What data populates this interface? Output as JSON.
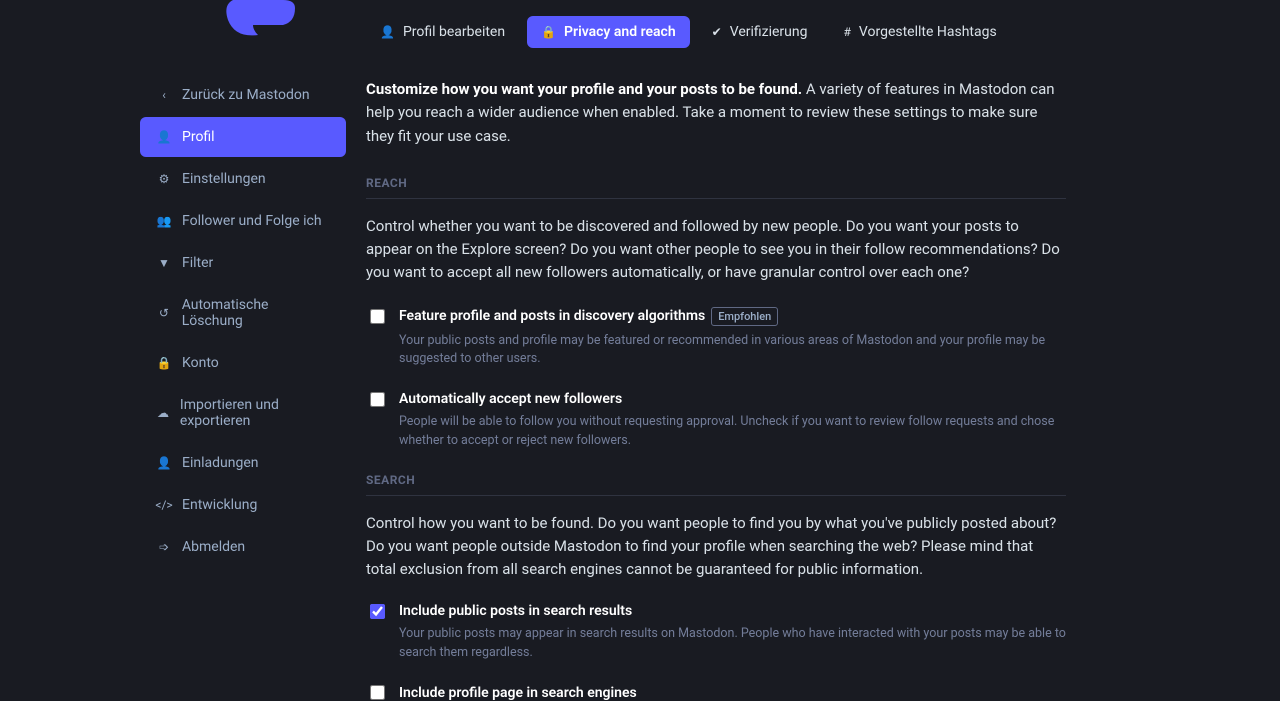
{
  "sidebar": {
    "back_label": "Zurück zu Mastodon",
    "items": [
      {
        "label": "Profil"
      },
      {
        "label": "Einstellungen"
      },
      {
        "label": "Follower und Folge ich"
      },
      {
        "label": "Filter"
      },
      {
        "label": "Automatische Löschung"
      },
      {
        "label": "Konto"
      },
      {
        "label": "Importieren und exportieren"
      },
      {
        "label": "Einladungen"
      },
      {
        "label": "Entwicklung"
      },
      {
        "label": "Abmelden"
      }
    ]
  },
  "tabs": {
    "edit": "Profil bearbeiten",
    "privacy": "Privacy and reach",
    "verify": "Verifizierung",
    "hashtags": "Vorgestellte Hashtags"
  },
  "intro": {
    "bold": "Customize how you want your profile and your posts to be found.",
    "rest": " A variety of features in Mastodon can help you reach a wider audience when enabled. Take a moment to review these settings to make sure they fit your use case."
  },
  "reach": {
    "header": "REACH",
    "desc": "Control whether you want to be discovered and followed by new people. Do you want your posts to appear on the Explore screen? Do you want other people to see you in their follow recommendations? Do you want to accept all new followers automatically, or have granular control over each one?",
    "feature": {
      "label": "Feature profile and posts in discovery algorithms",
      "badge": "Empfohlen",
      "hint": "Your public posts and profile may be featured or recommended in various areas of Mastodon and your profile may be suggested to other users."
    },
    "autoaccept": {
      "label": "Automatically accept new followers",
      "hint": "People will be able to follow you without requesting approval. Uncheck if you want to review follow requests and chose whether to accept or reject new followers."
    }
  },
  "search": {
    "header": "SEARCH",
    "desc": "Control how you want to be found. Do you want people to find you by what you've publicly posted about? Do you want people outside Mastodon to find your profile when searching the web? Please mind that total exclusion from all search engines cannot be guaranteed for public information.",
    "publicposts": {
      "label": "Include public posts in search results",
      "hint": "Your public posts may appear in search results on Mastodon. People who have interacted with your posts may be able to search them regardless."
    },
    "profilepage": {
      "label": "Include profile page in search engines"
    }
  }
}
